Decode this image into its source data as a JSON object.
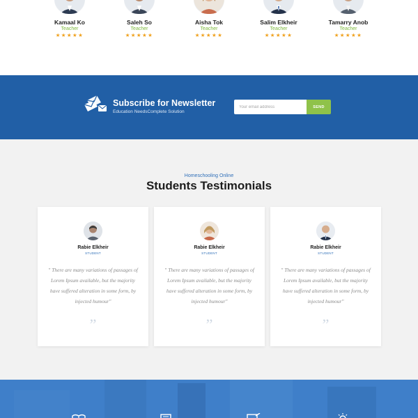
{
  "teachers": [
    {
      "name": "Kamaal Ko",
      "role": "Teacher",
      "stars": "★★★★★"
    },
    {
      "name": "Saleh So",
      "role": "Teacher",
      "stars": "★★★★★"
    },
    {
      "name": "Aisha Tok",
      "role": "Teacher",
      "stars": "★★★★★"
    },
    {
      "name": "Salim Elkheir",
      "role": "Teacher",
      "stars": "★★★★★"
    },
    {
      "name": "Tamarry Anob",
      "role": "Teacher",
      "stars": "★★★★★"
    }
  ],
  "newsletter": {
    "icon": "envelope-stack-icon",
    "title": "Subscribe for Newsletter",
    "subtitle": "Education NeedsComplete Solution",
    "email_placeholder": "Your email address",
    "send_label": "SEND"
  },
  "testimonials": {
    "kicker": "Homeschooling Online",
    "title": "Students Testimonials",
    "cards": [
      {
        "name": "Rabie Elkheir",
        "role": "STUDENT",
        "quote": "\" There are many variations of passages of Lorem Ipsum available, but the majority have suffered alteration in some form, by injected humour\"",
        "mark": "”"
      },
      {
        "name": "Rabie Elkheir",
        "role": "STUDENT",
        "quote": "\" There are many variations of passages of Lorem Ipsum available, but the majority have suffered alteration in some form, by injected humour\"",
        "mark": "”"
      },
      {
        "name": "Rabie Elkheir",
        "role": "STUDENT",
        "quote": "\" There are many variations of passages of Lorem Ipsum available, but the majority have suffered alteration in some form, by injected humour\"",
        "mark": "”"
      }
    ]
  },
  "colors": {
    "brand_blue": "#215fa6",
    "accent_green": "#8fc24a",
    "star_orange": "#f0a21f",
    "role_green": "#7cb83a"
  },
  "bottom_icons": [
    "book-icon",
    "certificate-icon",
    "laptop-icon",
    "lightbulb-icon"
  ]
}
